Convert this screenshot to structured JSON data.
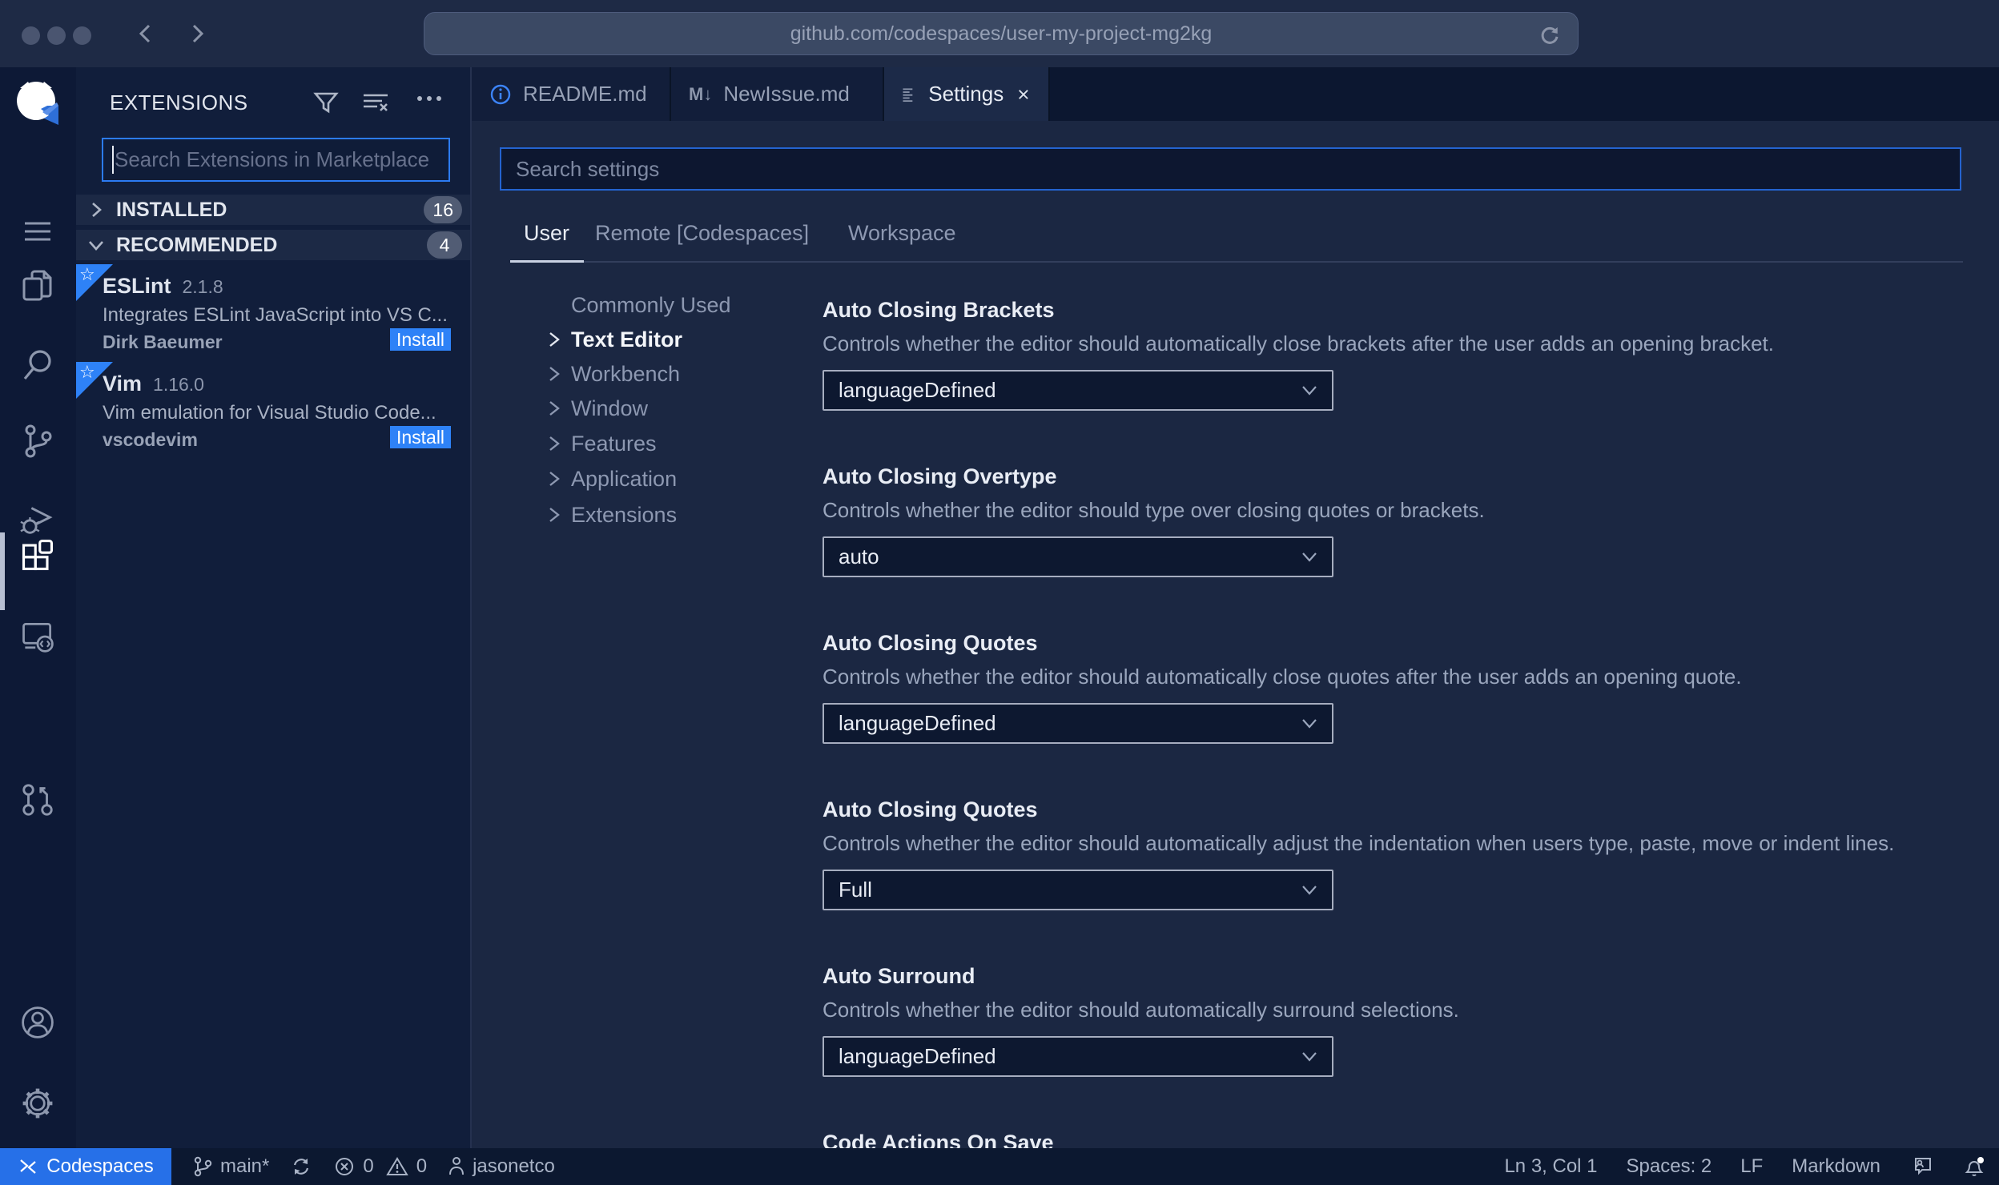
{
  "colors": {
    "accent": "#2e82f7",
    "chrome_bg": "#1e2a45",
    "bar_bg": "#0d1936",
    "sidebar_bg": "#111e3b",
    "editor_bg": "#1b2742",
    "tabbar_bg": "#0c1730",
    "tab_bg": "#121e3a",
    "tab_active_bg": "#1c2a48",
    "statusbar_bg": "#0c1830",
    "status_blue": "#2670e8",
    "input_bg": "#0d1730",
    "input_border": "#2463d0",
    "search_border": "#2c7bf2",
    "dropdown_border": "#a6adbf",
    "text_desc": "#9aa6bd",
    "row_bg": "#1c2945",
    "badge_bg": "#515c74",
    "url_bg": "#3b4964",
    "rule": "#323e5c"
  },
  "browser": {
    "url": "github.com/codespaces/user-my-project-mg2kg"
  },
  "activity_bar": {
    "icons": [
      "github-codespaces-logo",
      "menu",
      "explorer",
      "search",
      "source-control",
      "run-debug",
      "extensions",
      "remote-explorer",
      "pull-requests",
      "account",
      "settings-gear"
    ],
    "active": "extensions"
  },
  "sidebar": {
    "title": "EXTENSIONS",
    "search_placeholder": "Search Extensions in Marketplace",
    "sections": [
      {
        "label": "INSTALLED",
        "count": "16"
      },
      {
        "label": "RECOMMENDED",
        "count": "4"
      }
    ],
    "extensions": [
      {
        "name": "ESLint",
        "version": "2.1.8",
        "description": "Integrates ESLint JavaScript into VS C...",
        "publisher": "Dirk Baeumer",
        "action": "Install"
      },
      {
        "name": "Vim",
        "version": "1.16.0",
        "description": "Vim emulation for Visual Studio Code...",
        "publisher": "vscodevim",
        "action": "Install"
      }
    ]
  },
  "editor": {
    "tabs": [
      {
        "label": "README.md"
      },
      {
        "label": "NewIssue.md"
      },
      {
        "label": "Settings"
      }
    ],
    "settings": {
      "search_placeholder": "Search settings",
      "scopes": [
        {
          "label": "User"
        },
        {
          "label": "Remote [Codespaces]"
        },
        {
          "label": "Workspace"
        }
      ],
      "tree": [
        "Commonly Used",
        "Text Editor",
        "Workbench",
        "Window",
        "Features",
        "Application",
        "Extensions"
      ],
      "items": [
        {
          "title": "Auto Closing Brackets",
          "description": "Controls whether the editor should automatically close brackets after the user adds an opening bracket.",
          "value": "languageDefined"
        },
        {
          "title": "Auto Closing Overtype",
          "description": "Controls whether the editor should type over closing quotes or brackets.",
          "value": "auto"
        },
        {
          "title": "Auto Closing Quotes",
          "description": "Controls whether the editor should automatically close quotes after the user adds an opening quote.",
          "value": "languageDefined"
        },
        {
          "title": "Auto Closing Quotes",
          "description": "Controls whether the editor should automatically adjust the indentation when users type, paste, move or indent lines.",
          "value": "Full"
        },
        {
          "title": "Auto Surround",
          "description": "Controls whether the editor should automatically surround selections.",
          "value": "languageDefined"
        },
        {
          "title": "Code Actions On Save",
          "description": "",
          "value": ""
        }
      ]
    }
  },
  "status_bar": {
    "remote_label": "Codespaces",
    "branch": "main*",
    "errors": "0",
    "warnings": "0",
    "user": "jasonetco",
    "cursor": "Ln 3, Col 1",
    "indent": "Spaces: 2",
    "eol": "LF",
    "language": "Markdown"
  }
}
